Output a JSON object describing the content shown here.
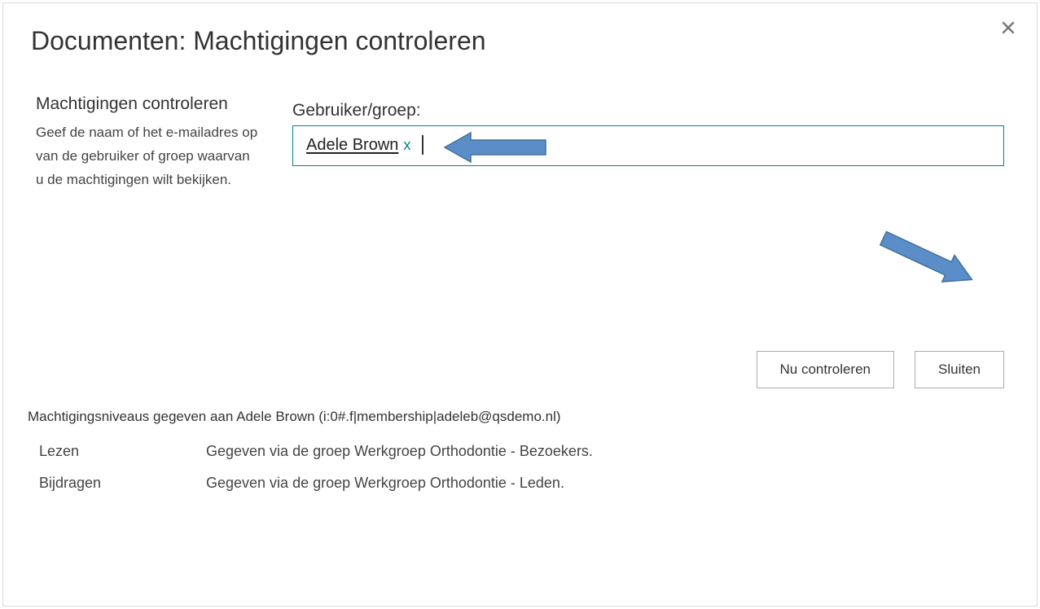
{
  "dialog": {
    "title": "Documenten: Machtigingen controleren",
    "close_aria": "Sluiten"
  },
  "left": {
    "section_title": "Machtigingen controleren",
    "section_desc": "Geef de naam of het e-mailadres op van de gebruiker of groep waarvan u de machtigingen wilt bekijken."
  },
  "field": {
    "label": "Gebruiker/groep:",
    "chip_name": "Adele Brown",
    "chip_remove": "x"
  },
  "buttons": {
    "check_now": "Nu controleren",
    "close": "Sluiten"
  },
  "results": {
    "header": "Machtigingsniveaus gegeven aan Adele Brown (i:0#.f|membership|adeleb@qsdemo.nl)",
    "rows": [
      {
        "level": "Lezen",
        "source": "Gegeven via de groep Werkgroep Orthodontie - Bezoekers."
      },
      {
        "level": "Bijdragen",
        "source": "Gegeven via de groep Werkgroep Orthodontie - Leden."
      }
    ]
  },
  "annotation": {
    "arrow_fill": "#5b8dc9",
    "arrow_stroke": "#41719c"
  }
}
